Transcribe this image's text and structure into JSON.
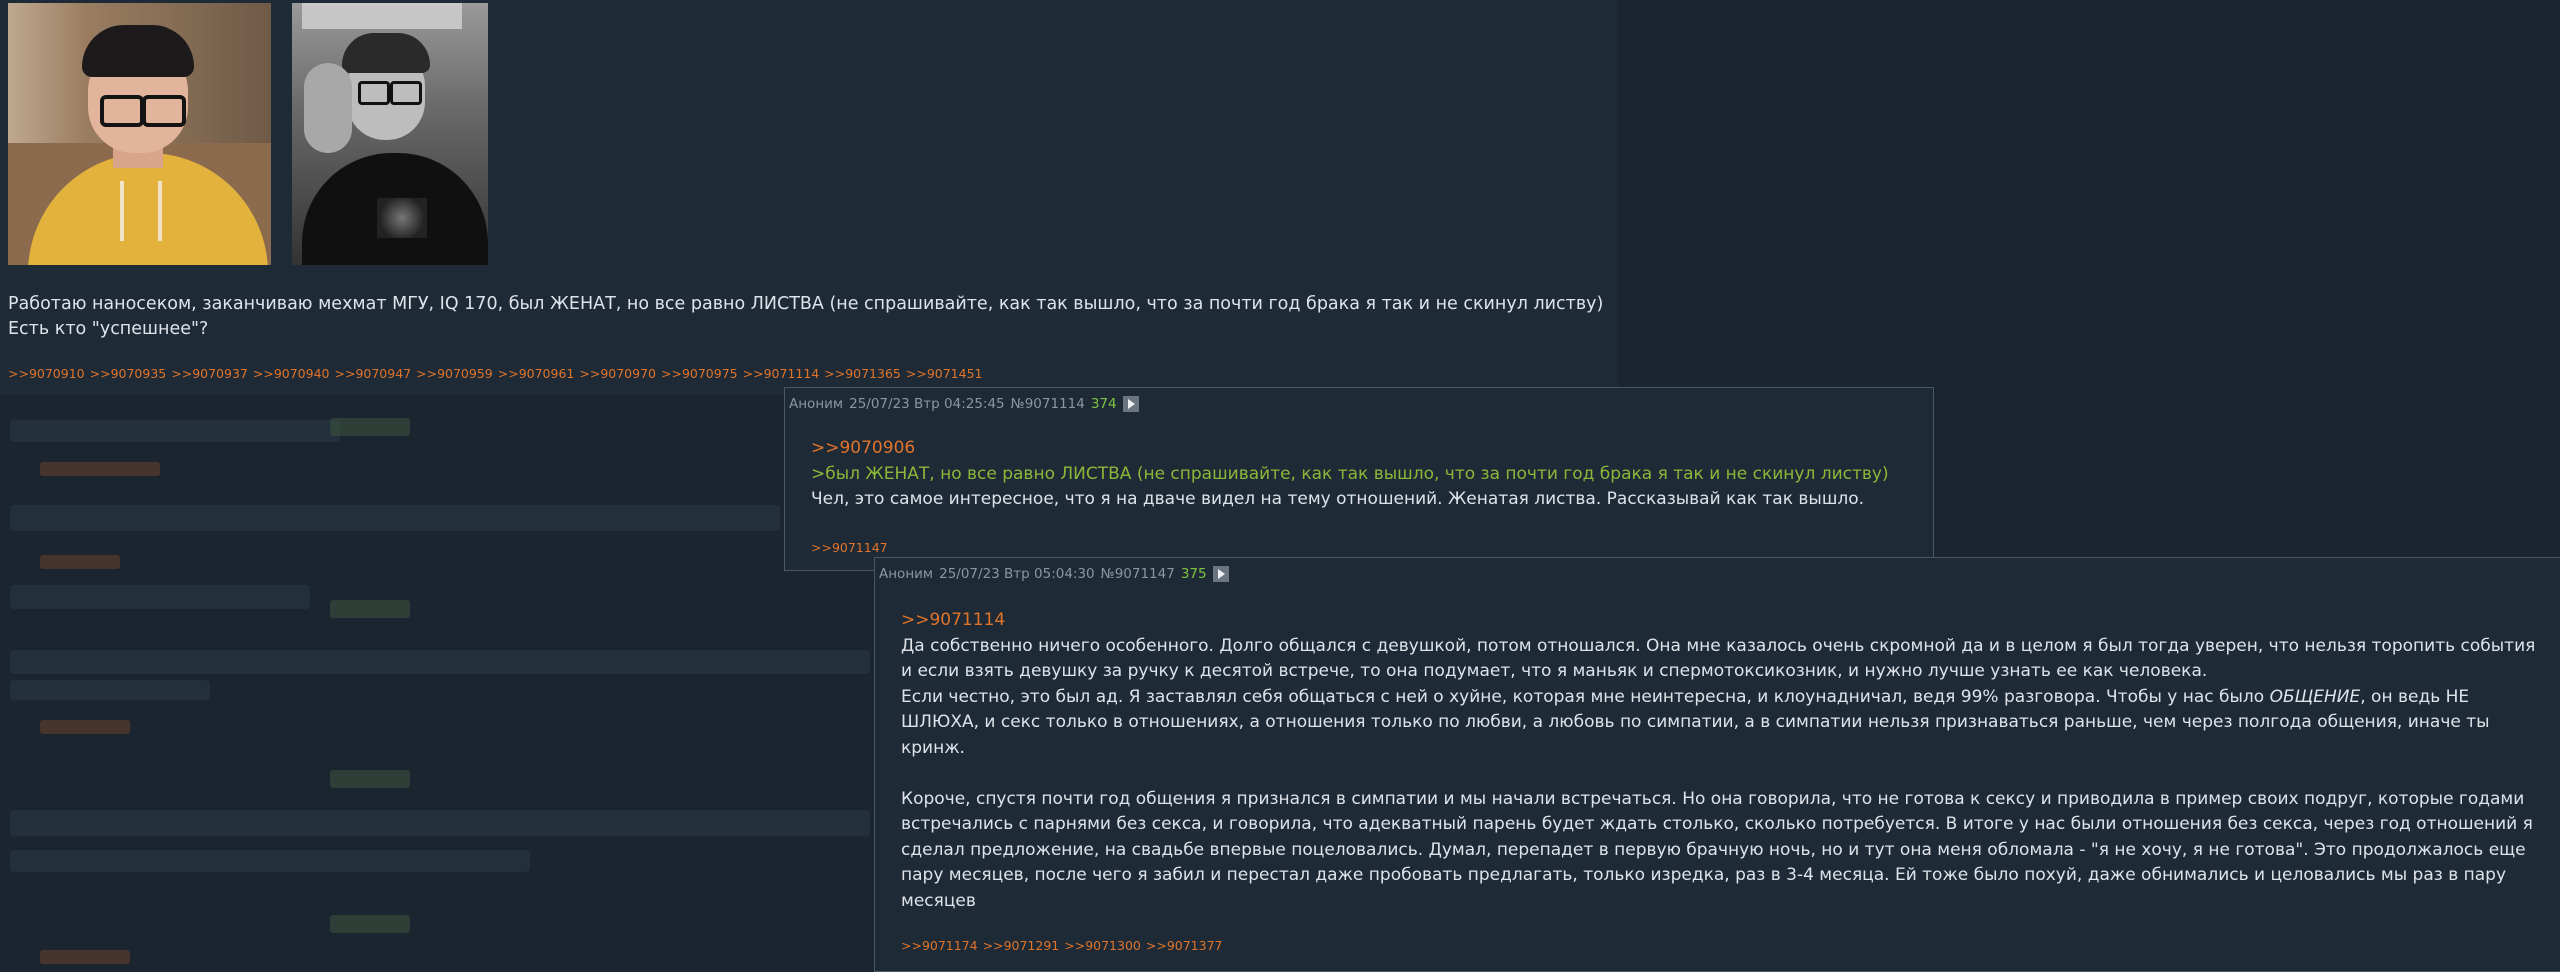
{
  "op_post": {
    "text_line1": "Работаю наносеком, заканчиваю мехмат МГУ, IQ 170, был ЖЕНАТ, но все равно ЛИСТВА (не спрашивайте, как так вышло, что за почти год брака я так и не скинул листву)",
    "text_line2": "Есть кто \"успешнее\"?",
    "replies": [
      ">>9070910",
      ">>9070935",
      ">>9070937",
      ">>9070940",
      ">>9070947",
      ">>9070959",
      ">>9070961",
      ">>9070970",
      ">>9070975",
      ">>9071114",
      ">>9071365",
      ">>9071451"
    ]
  },
  "reply1": {
    "name": "Аноним",
    "date": "25/07/23 Втр 04:25:45",
    "num": "№9071114",
    "count": "374",
    "quote_link": ">>9070906",
    "greentext": ">был ЖЕНАТ, но все равно ЛИСТВА (не спрашивайте, как так вышло, что за почти год брака я так и не скинул листву)",
    "body": "Чел, это самое интересное, что я на дваче видел на тему отношений. Женатая листва. Рассказывай как так вышло.",
    "replies": [
      ">>9071147"
    ]
  },
  "reply2": {
    "name": "Аноним",
    "date": "25/07/23 Втр 05:04:30",
    "num": "№9071147",
    "count": "375",
    "quote_link": ">>9071114",
    "p1": "Да собственно ничего особенного. Долго общался с девушкой, потом отношался. Она мне казалось очень скромной да и в целом я был тогда уверен, что нельзя торопить события и если взять девушку за ручку к десятой встрече, то она подумает, что я маньяк и спермотоксикозник, и нужно лучше узнать ее как человека.",
    "p2_a": "Если честно, это был ад. Я заставлял себя общаться с ней о хуйне, которая мне неинтересна, и клоунадничал, ведя 99% разговора. Чтобы у нас было ",
    "p2_em": "ОБЩЕНИЕ",
    "p2_b": ", он ведь НЕ ШЛЮХА, и секс только в отношениях, а отношения только по любви, а любовь по симпатии, а в симпатии нельзя признаваться раньше, чем через полгода общения, иначе ты кринж.",
    "p3": "Короче, спустя почти год общения я признался в симпатии и мы начали встречаться. Но она говорила, что не готова к сексу и приводила в пример своих подруг, которые годами встречались с парнями без секса, и говорила, что адекватный парень будет ждать столько, сколько потребуется. В итоге у нас были отношения без секса, через год отношений я сделал предложение, на свадьбе впервые поцеловались. Думал, перепадет в первую брачную ночь, но и тут она меня обломала - \"я не хочу, я не готова\". Это продолжалось еще пару месяцев, после чего я забил и перестал даже пробовать предлагать, только изредка, раз в 3-4 месяца. Ей тоже было похуй, даже обнимались и целовались мы раз в пару месяцев",
    "replies": [
      ">>9071174",
      ">>9071291",
      ">>9071300",
      ">>9071377"
    ]
  },
  "colors": {
    "background": "#1b2530",
    "post_bg": "#1e2a36",
    "link": "#e0742a",
    "greentext": "#8cb83a",
    "post_count": "#7ec542"
  }
}
